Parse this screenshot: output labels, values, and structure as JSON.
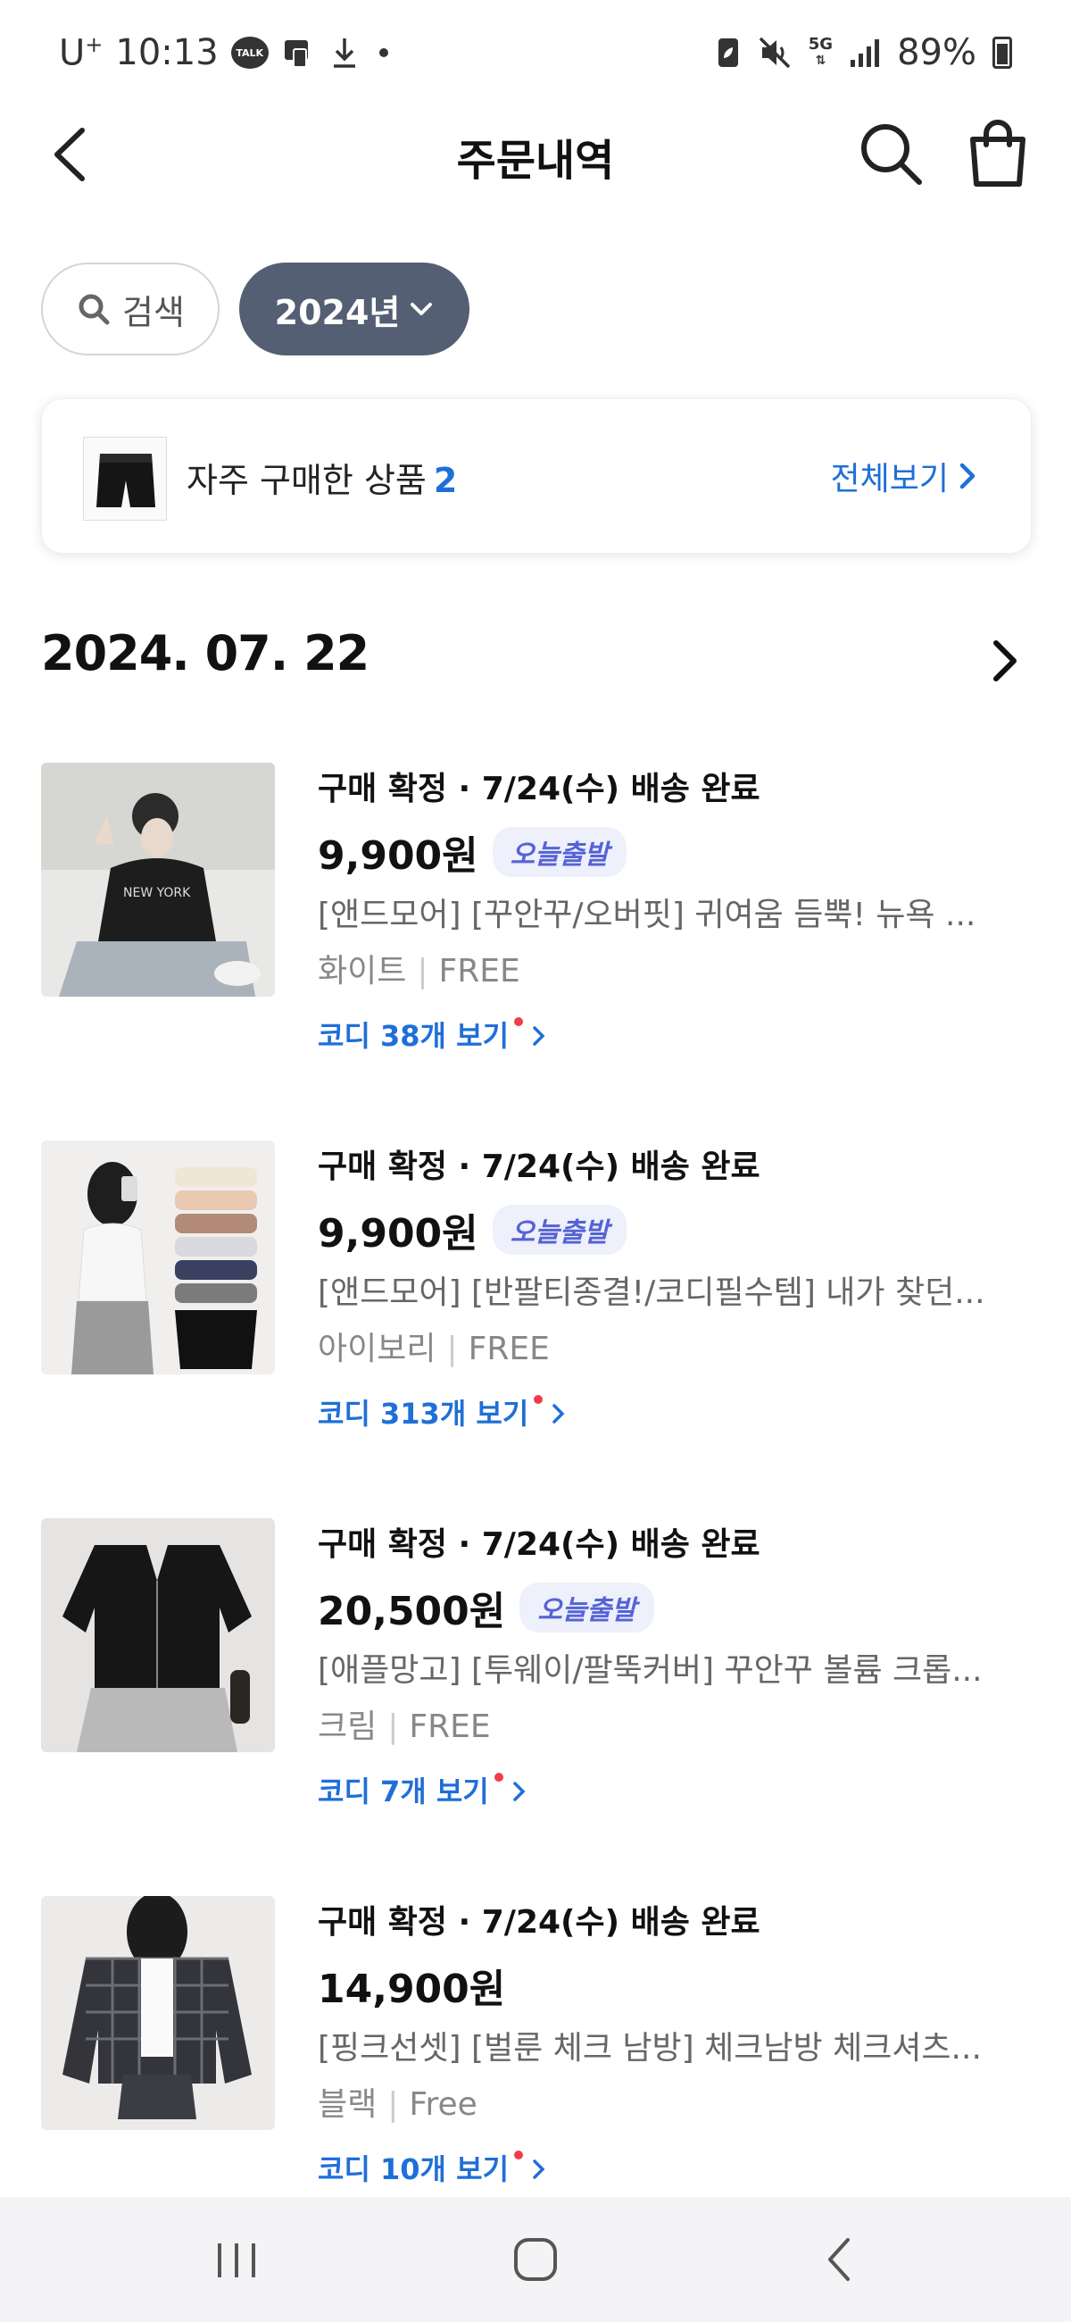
{
  "status_bar": {
    "carrier": "U",
    "carrier_plus": "+",
    "time": "10:13",
    "talk_label": "TALK",
    "network": "5G",
    "battery": "89%"
  },
  "header": {
    "title": "주문내역"
  },
  "filters": {
    "search_label": "검색",
    "year_label": "2024년"
  },
  "frequent": {
    "label": "자주 구매한 상품",
    "count": "2",
    "view_all": "전체보기"
  },
  "date": "2024. 07. 22",
  "orders": [
    {
      "status": "구매 확정 · 7/24(수) 배송 완료",
      "price": "9,900원",
      "badge": "오늘출발",
      "name": "[앤드모어] [꾸안꾸/오버핏] 귀여움 듬뿍! 뉴욕 ...",
      "color": "화이트",
      "size": "FREE",
      "codi": "코디 38개 보기"
    },
    {
      "status": "구매 확정 · 7/24(수) 배송 완료",
      "price": "9,900원",
      "badge": "오늘출발",
      "name": "[앤드모어] [반팔티종결!/코디필수템] 내가 찾던...",
      "color": "아이보리",
      "size": "FREE",
      "codi": "코디 313개 보기"
    },
    {
      "status": "구매 확정 · 7/24(수) 배송 완료",
      "price": "20,500원",
      "badge": "오늘출발",
      "name": "[애플망고] [투웨이/팔뚝커버] 꾸안꾸 볼륨 크롭...",
      "color": "크림",
      "size": "FREE",
      "codi": "코디 7개 보기"
    },
    {
      "status": "구매 확정 · 7/24(수) 배송 완료",
      "price": "14,900원",
      "badge": "",
      "name": "[핑크선셋] [벌룬 체크 남방] 체크남방 체크셔츠...",
      "color": "블랙",
      "size": "Free",
      "codi": "코디 10개 보기"
    }
  ]
}
